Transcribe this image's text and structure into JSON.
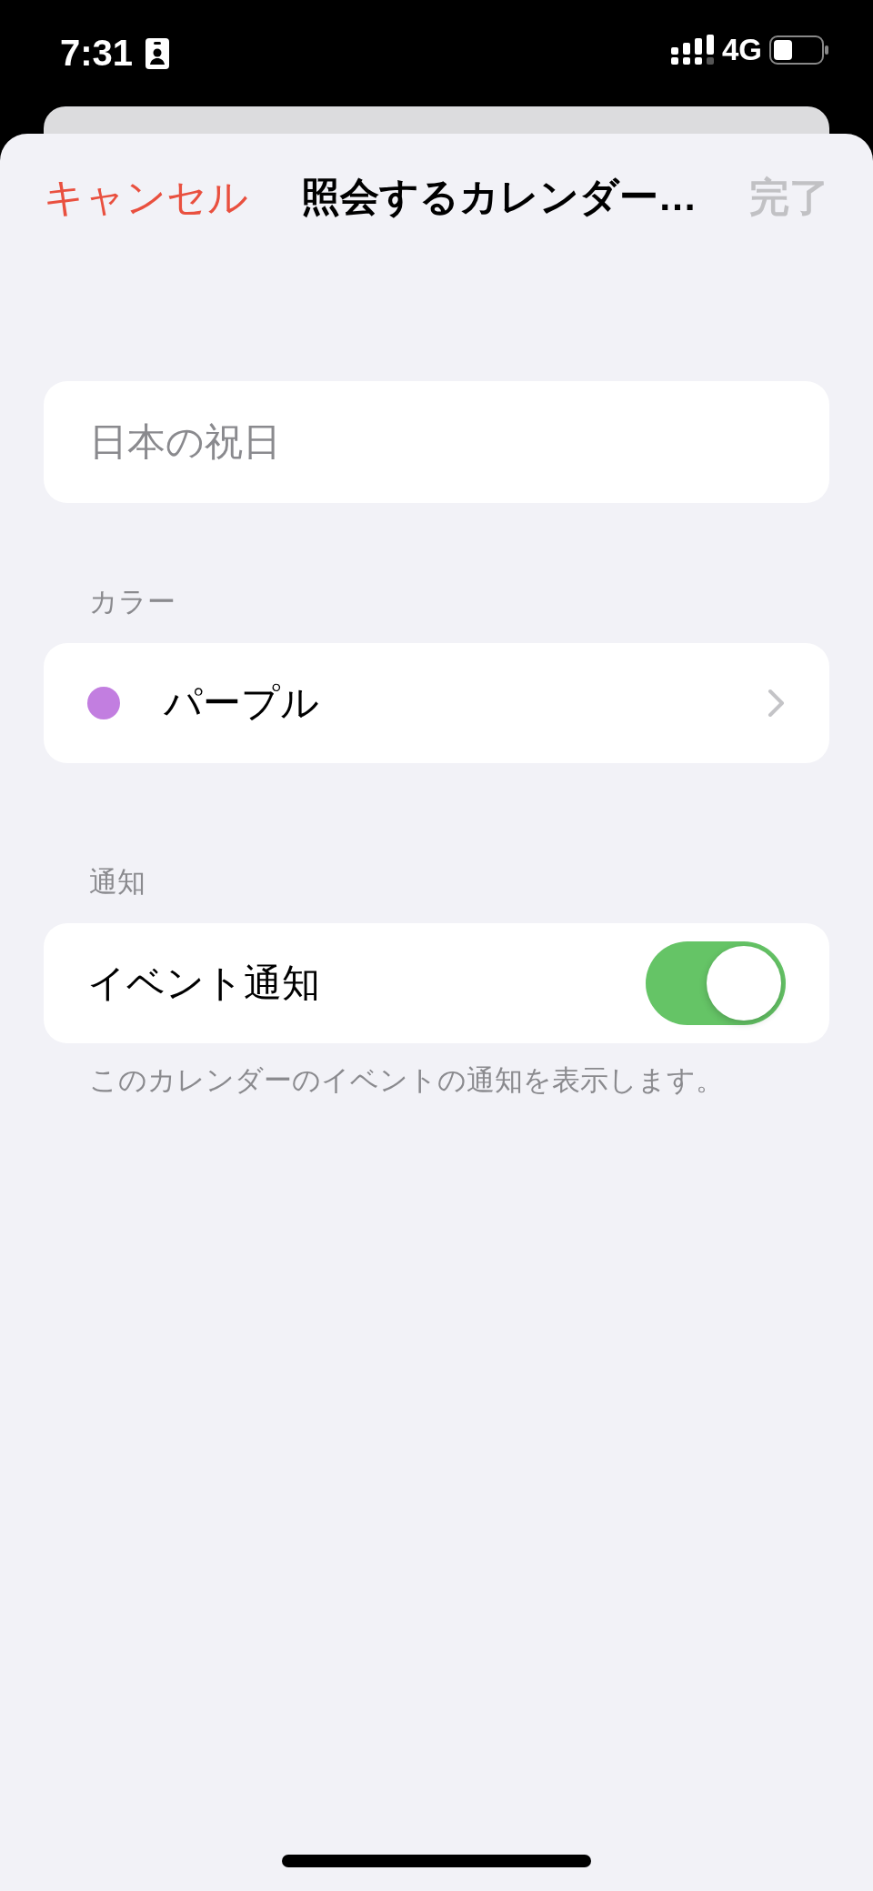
{
  "status_bar": {
    "time": "7:31",
    "network": "4G"
  },
  "nav": {
    "cancel": "キャンセル",
    "title": "照会するカレンダー…",
    "done": {
      "label": "完了",
      "disabled": true
    }
  },
  "name_field": {
    "placeholder": "日本の祝日"
  },
  "color_section": {
    "header": "カラー",
    "item": {
      "label": "パープル",
      "color": "#c27ee0"
    }
  },
  "notification_section": {
    "header": "通知",
    "item": {
      "label": "イベント通知",
      "on": true
    },
    "footer": "このカレンダーのイベントの通知を表示します。"
  }
}
